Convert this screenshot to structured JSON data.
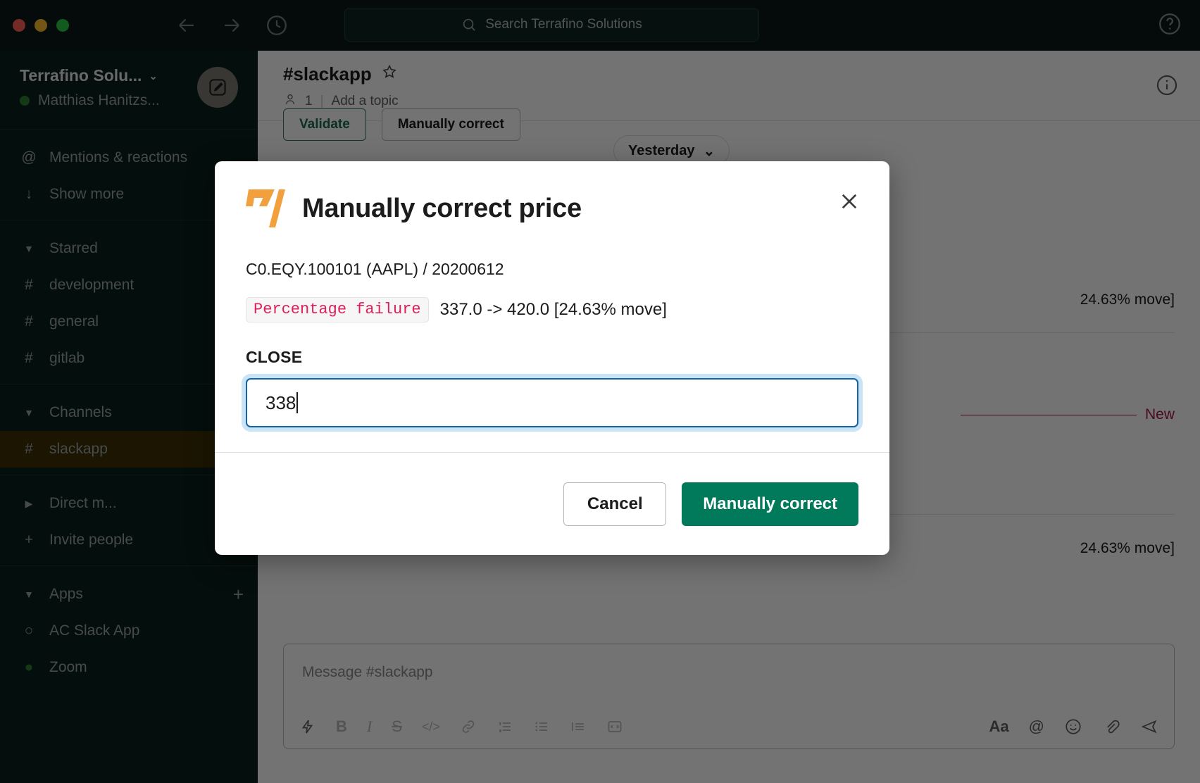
{
  "titlebar": {
    "search_placeholder": "Search Terrafino Solutions",
    "back_icon": "back-arrow-icon",
    "forward_icon": "forward-arrow-icon",
    "history_icon": "clock-history-icon",
    "help_icon": "help-circle-icon",
    "search_icon": "search-icon"
  },
  "sidebar": {
    "workspace_name": "Terrafino Solu...",
    "workspace_chevron": "⌄",
    "user_name": "Matthias Hanitzs...",
    "compose_icon": "compose-pencil-icon",
    "quick": [
      {
        "icon": "at-icon",
        "glyph": "@",
        "label": "Mentions & reactions"
      },
      {
        "icon": "arrow-down-icon",
        "glyph": "↓",
        "label": "Show more"
      }
    ],
    "groups": [
      {
        "label": "Starred",
        "expanded": true,
        "items": [
          {
            "glyph": "#",
            "label": "development",
            "active": false
          },
          {
            "glyph": "#",
            "label": "general",
            "active": false
          },
          {
            "glyph": "#",
            "label": "gitlab",
            "active": false
          }
        ]
      },
      {
        "label": "Channels",
        "expanded": true,
        "add": "+",
        "items": [
          {
            "glyph": "#",
            "label": "slackapp",
            "active": true
          }
        ]
      },
      {
        "label": "Direct m...",
        "expanded": false,
        "add": "+",
        "items": [
          {
            "glyph": "+",
            "label": "Invite people",
            "active": false
          }
        ]
      },
      {
        "label": "Apps",
        "expanded": true,
        "add": "+",
        "items": [
          {
            "glyph": "○",
            "label": "AC Slack App",
            "active": false
          },
          {
            "glyph": "●",
            "label": "Zoom",
            "active": false
          }
        ]
      }
    ]
  },
  "channel": {
    "name": "#slackapp",
    "star_icon": "star-outline-icon",
    "members_icon": "person-icon",
    "member_count": "1",
    "topic": "Add a topic",
    "info_icon": "info-circle-icon",
    "actions": [
      {
        "label": "Validate",
        "style": "green"
      },
      {
        "label": "Manually correct",
        "style": "plain"
      }
    ],
    "date_pill": "Yesterday",
    "date_pill_chevron": "⌄",
    "messages": [
      {
        "text": "24.63% move]"
      },
      {
        "text": "24.63% move]"
      }
    ],
    "new_divider_label": "New"
  },
  "composer": {
    "placeholder": "Message #slackapp",
    "tools_left": [
      {
        "icon": "lightning-shortcut-icon",
        "glyph": "⚡"
      },
      {
        "icon": "bold-icon",
        "glyph": "B"
      },
      {
        "icon": "italic-icon",
        "glyph": "I"
      },
      {
        "icon": "strikethrough-icon",
        "glyph": "S"
      },
      {
        "icon": "code-icon",
        "glyph": "</>"
      },
      {
        "icon": "link-icon",
        "glyph": "🔗"
      },
      {
        "icon": "ordered-list-icon",
        "glyph": "1≡"
      },
      {
        "icon": "bulleted-list-icon",
        "glyph": "•≡"
      },
      {
        "icon": "blockquote-icon",
        "glyph": "≡"
      },
      {
        "icon": "code-block-icon",
        "glyph": "⌷"
      }
    ],
    "tools_right": [
      {
        "icon": "format-text-icon",
        "glyph": "Aa"
      },
      {
        "icon": "mention-icon",
        "glyph": "@"
      },
      {
        "icon": "emoji-icon",
        "glyph": "☺"
      },
      {
        "icon": "attachment-icon",
        "glyph": "📎"
      },
      {
        "icon": "send-icon",
        "glyph": "➤"
      }
    ]
  },
  "modal": {
    "logo_icon": "terrafino-logo-icon",
    "title": "Manually correct price",
    "close_icon": "close-icon",
    "context": "C0.EQY.100101 (AAPL) / 20200612",
    "failure_badge": "Percentage failure",
    "failure_detail": "337.0 -> 420.0 [24.63% move]",
    "field_label": "CLOSE",
    "field_value": "338",
    "cancel_label": "Cancel",
    "submit_label": "Manually correct"
  },
  "colors": {
    "sidebar_bg": "#0a1f1c",
    "active_channel_bg": "#3d2f05",
    "primary_green": "#007a5a",
    "badge_text": "#e01e5a",
    "focus_ring": "#c9e3f7",
    "focus_border": "#1264a3",
    "logo_orange": "#f2a03d",
    "new_marker": "#a51a3f"
  }
}
